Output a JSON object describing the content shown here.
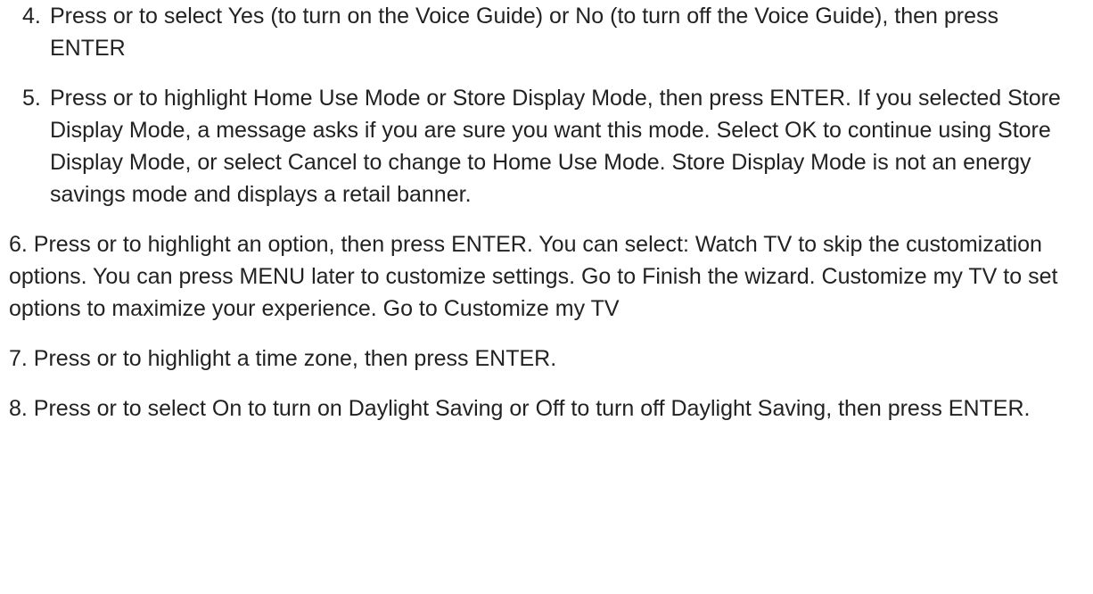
{
  "list": {
    "items": [
      {
        "number": "4.",
        "text": "Press or to select Yes (to turn on the Voice Guide) or No (to turn off the Voice Guide), then press ENTER"
      },
      {
        "number": "5.",
        "text": "Press or to highlight Home Use Mode or Store Display Mode, then press ENTER. If you selected Store Display Mode, a message asks if you are sure you want this mode. Select OK to continue using Store Display Mode, or select Cancel to change to Home Use Mode. Store Display Mode is not an energy savings mode and displays a retail banner."
      }
    ]
  },
  "paragraphs": [
    "6. Press or to highlight an option, then press ENTER. You can select: Watch TV to skip the customization options. You can press MENU later to customize settings. Go to Finish the wizard. Customize my TV to set options to maximize your experience. Go to Customize my TV",
    "7. Press or to highlight a time zone, then press ENTER.",
    "8. Press or to select On to turn on Daylight Saving or Off to turn off Daylight Saving, then press ENTER."
  ]
}
